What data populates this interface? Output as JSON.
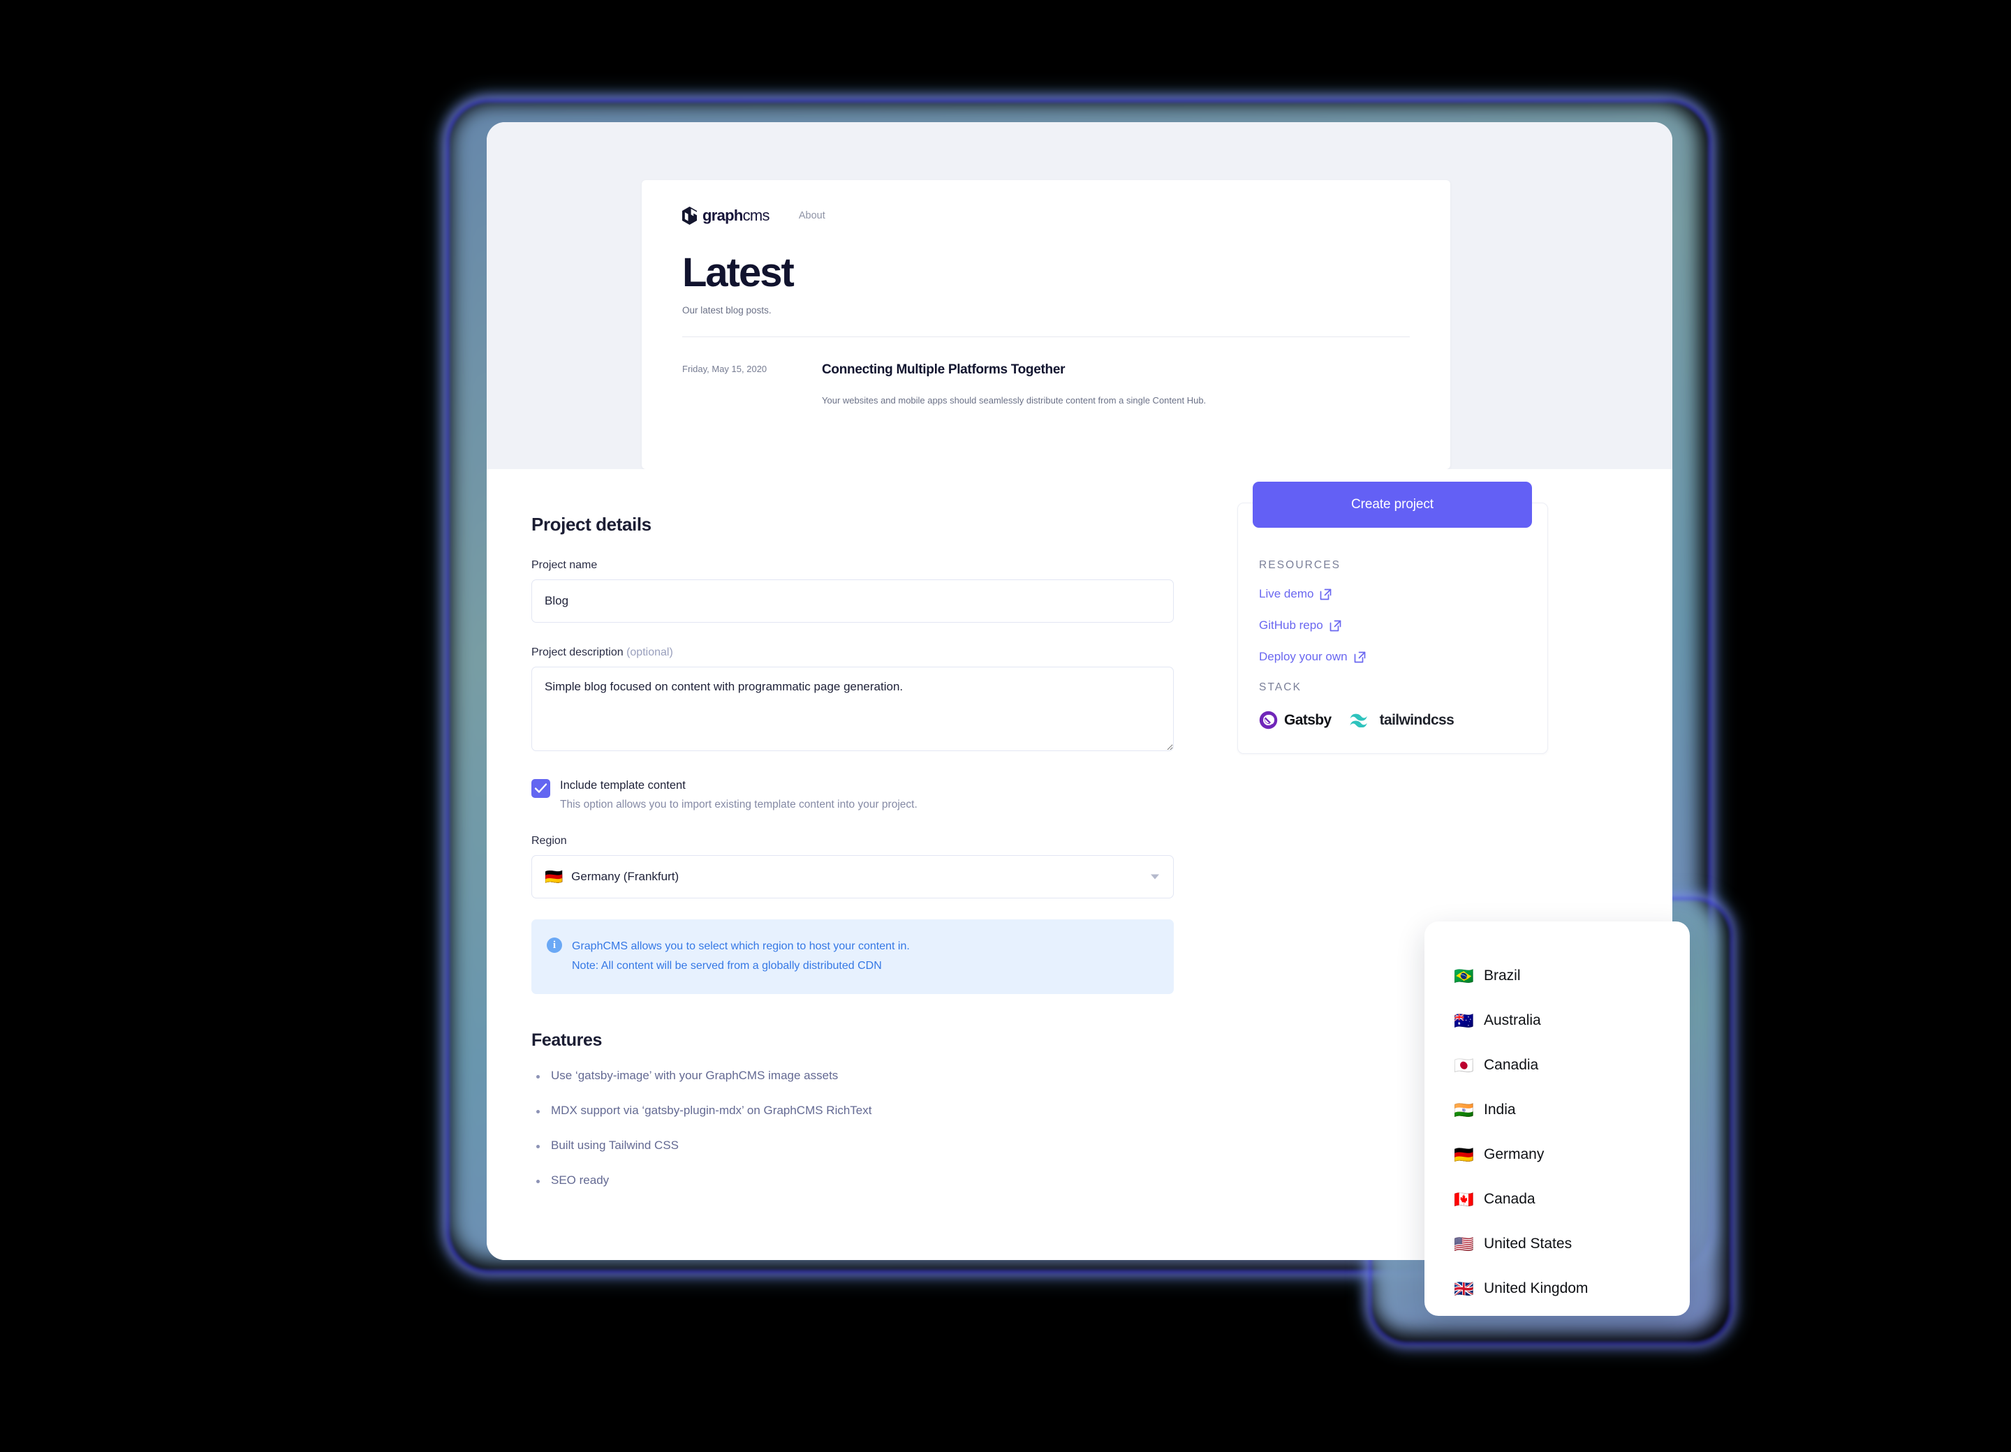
{
  "preview": {
    "logo_text_bold": "graph",
    "logo_text_thin": "cms",
    "nav_about": "About",
    "title": "Latest",
    "subtitle": "Our latest blog posts.",
    "post": {
      "date": "Friday, May 15, 2020",
      "title": "Connecting Multiple Platforms Together",
      "excerpt": "Your websites and mobile apps should seamlessly distribute content from a single Content Hub."
    }
  },
  "form": {
    "section_title": "Project details",
    "project_name": {
      "label": "Project name",
      "value": "Blog"
    },
    "project_description": {
      "label": "Project description",
      "optional_tag": "(optional)",
      "value": "Simple blog focused on content with programmatic page generation."
    },
    "include_template": {
      "label": "Include template content",
      "help": "This option allows you to import existing template content into your project.",
      "checked": true
    },
    "region": {
      "label": "Region",
      "selected_flag": "🇩🇪",
      "selected_value": "Germany (Frankfurt)"
    },
    "info": {
      "line1": "GraphCMS allows you to select which region to host your content in.",
      "line2": "Note: All content will be served from a globally distributed CDN",
      "icon": "info-icon"
    },
    "features_title": "Features",
    "features": [
      "Use ‘gatsby-image’ with your GraphCMS image assets",
      "MDX support via ‘gatsby-plugin-mdx’ on GraphCMS RichText",
      "Built using Tailwind CSS",
      "SEO ready"
    ]
  },
  "sidebar": {
    "create_button": "Create project",
    "resources_heading": "RESOURCES",
    "resources": [
      {
        "label": "Live demo",
        "icon": "external-link-icon"
      },
      {
        "label": "GitHub repo",
        "icon": "external-link-icon"
      },
      {
        "label": "Deploy your own",
        "icon": "external-link-icon"
      }
    ],
    "stack_heading": "STACK",
    "stack": [
      {
        "label": "Gatsby",
        "icon": "gatsby-logo-icon"
      },
      {
        "label": "tailwindcss",
        "icon": "tailwindcss-logo-icon"
      }
    ]
  },
  "dropdown": {
    "items": [
      {
        "flag": "🇧🇷",
        "label": "Brazil"
      },
      {
        "flag": "🇦🇺",
        "label": "Australia"
      },
      {
        "flag": "🇯🇵",
        "label": "Canadia"
      },
      {
        "flag": "🇮🇳",
        "label": "India"
      },
      {
        "flag": "🇩🇪",
        "label": "Germany"
      },
      {
        "flag": "🇨🇦",
        "label": "Canada"
      },
      {
        "flag": "🇺🇸",
        "label": "United States"
      },
      {
        "flag": "🇬🇧",
        "label": "United Kingdom"
      }
    ]
  },
  "colors": {
    "accent": "#6360f5",
    "checkbox": "#6366f1",
    "link": "#6a67f0",
    "info_bg": "#e7f1fe",
    "info_text": "#3578e5",
    "preview_bg": "#f0f2f7"
  }
}
